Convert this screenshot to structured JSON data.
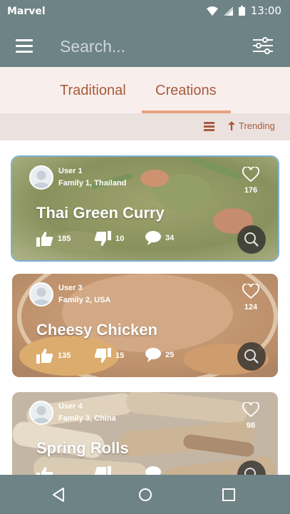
{
  "status_bar": {
    "carrier": "Marvel",
    "time": "13:00"
  },
  "app_bar": {
    "search_placeholder": "Search...",
    "menu_icon": "hamburger-menu-icon",
    "filter_icon": "filter-sliders-icon"
  },
  "tabs": [
    {
      "label": "Traditional",
      "active": false
    },
    {
      "label": "Creations",
      "active": true
    }
  ],
  "sort": {
    "label": "Trending",
    "view_icon": "list-view-icon",
    "sort_icon": "arrow-up-icon"
  },
  "cards": [
    {
      "user": "User 1",
      "meta": "Family 1, Thailand",
      "title": "Thai Green Curry",
      "likes": "176",
      "thumbs_up": "185",
      "thumbs_down": "10",
      "comments": "34",
      "selected": true
    },
    {
      "user": "User 3",
      "meta": "Family 2, USA",
      "title": "Cheesy Chicken",
      "likes": "124",
      "thumbs_up": "135",
      "thumbs_down": "15",
      "comments": "25",
      "selected": false
    },
    {
      "user": "User 4",
      "meta": "Family 3, China",
      "title": "Spring Rolls",
      "likes": "98",
      "thumbs_up": "",
      "thumbs_down": "",
      "comments": "",
      "selected": false
    }
  ],
  "colors": {
    "header": "#6e8386",
    "accent": "#a85a3c",
    "tab_indicator": "#e8a37f",
    "tabs_background": "#f8efec"
  }
}
